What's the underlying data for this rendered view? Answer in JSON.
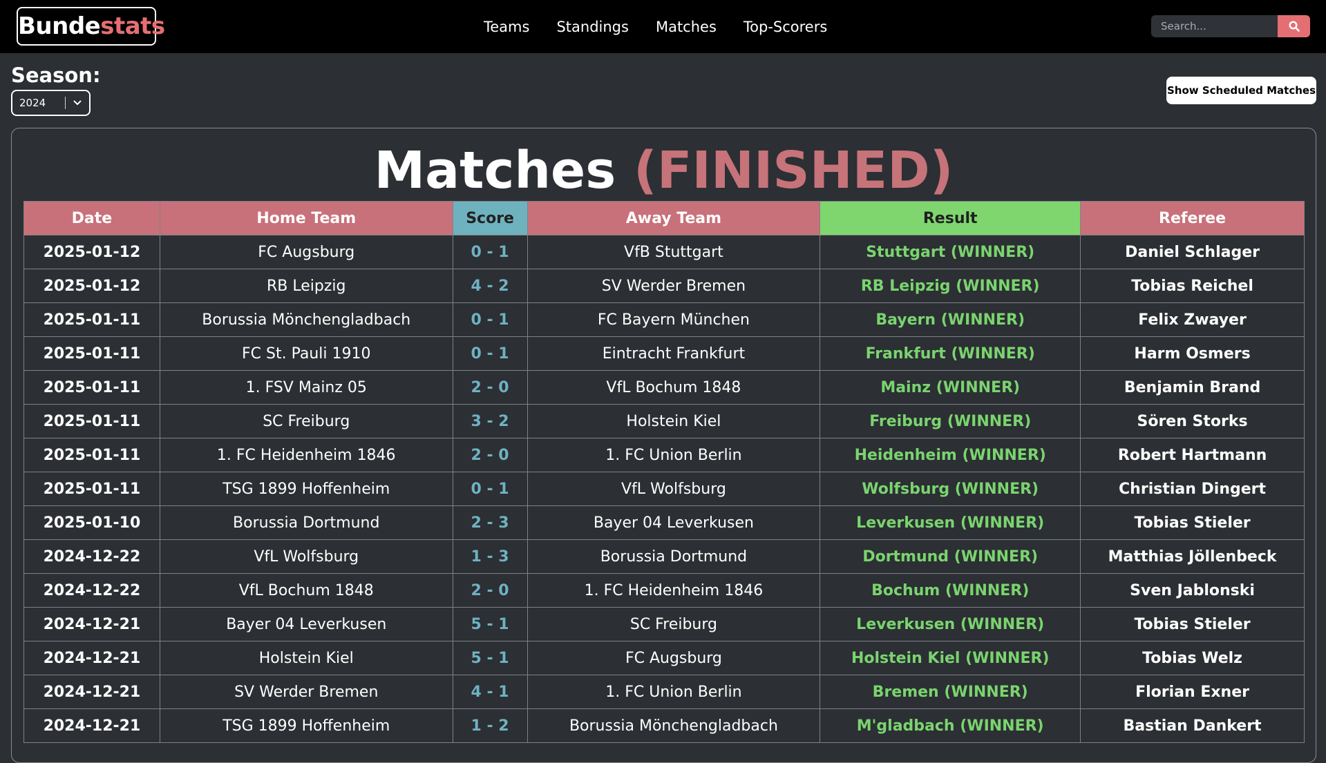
{
  "brand": {
    "part1": "Bunde",
    "part2": "stats"
  },
  "nav": {
    "items": [
      "Teams",
      "Standings",
      "Matches",
      "Top-Scorers"
    ]
  },
  "search": {
    "placeholder": "Search..."
  },
  "season": {
    "label": "Season:",
    "value": "2024"
  },
  "scheduled_button": "Show Scheduled Matches",
  "panel": {
    "title": "Matches",
    "status": "(FINISHED)"
  },
  "colors": {
    "accent": "#e46f72",
    "header_red": "#c8717a",
    "header_blue": "#6fb2bf",
    "header_green": "#7fd66e",
    "score": "#6eb2c3",
    "winner": "#7ad46f"
  },
  "icons": {
    "search": "search-icon",
    "dropdown": "chevron-down-icon"
  },
  "table": {
    "headers": [
      "Date",
      "Home Team",
      "Score",
      "Away Team",
      "Result",
      "Referee"
    ],
    "rows": [
      [
        "2025-01-12",
        "FC Augsburg",
        "0 - 1",
        "VfB Stuttgart",
        "Stuttgart (WINNER)",
        "Daniel Schlager"
      ],
      [
        "2025-01-12",
        "RB Leipzig",
        "4 - 2",
        "SV Werder Bremen",
        "RB Leipzig (WINNER)",
        "Tobias Reichel"
      ],
      [
        "2025-01-11",
        "Borussia Mönchengladbach",
        "0 - 1",
        "FC Bayern München",
        "Bayern (WINNER)",
        "Felix Zwayer"
      ],
      [
        "2025-01-11",
        "FC St. Pauli 1910",
        "0 - 1",
        "Eintracht Frankfurt",
        "Frankfurt (WINNER)",
        "Harm Osmers"
      ],
      [
        "2025-01-11",
        "1. FSV Mainz 05",
        "2 - 0",
        "VfL Bochum 1848",
        "Mainz (WINNER)",
        "Benjamin Brand"
      ],
      [
        "2025-01-11",
        "SC Freiburg",
        "3 - 2",
        "Holstein Kiel",
        "Freiburg (WINNER)",
        "Sören Storks"
      ],
      [
        "2025-01-11",
        "1. FC Heidenheim 1846",
        "2 - 0",
        "1. FC Union Berlin",
        "Heidenheim (WINNER)",
        "Robert Hartmann"
      ],
      [
        "2025-01-11",
        "TSG 1899 Hoffenheim",
        "0 - 1",
        "VfL Wolfsburg",
        "Wolfsburg (WINNER)",
        "Christian Dingert"
      ],
      [
        "2025-01-10",
        "Borussia Dortmund",
        "2 - 3",
        "Bayer 04 Leverkusen",
        "Leverkusen (WINNER)",
        "Tobias Stieler"
      ],
      [
        "2024-12-22",
        "VfL Wolfsburg",
        "1 - 3",
        "Borussia Dortmund",
        "Dortmund (WINNER)",
        "Matthias Jöllenbeck"
      ],
      [
        "2024-12-22",
        "VfL Bochum 1848",
        "2 - 0",
        "1. FC Heidenheim 1846",
        "Bochum (WINNER)",
        "Sven Jablonski"
      ],
      [
        "2024-12-21",
        "Bayer 04 Leverkusen",
        "5 - 1",
        "SC Freiburg",
        "Leverkusen (WINNER)",
        "Tobias Stieler"
      ],
      [
        "2024-12-21",
        "Holstein Kiel",
        "5 - 1",
        "FC Augsburg",
        "Holstein Kiel (WINNER)",
        "Tobias Welz"
      ],
      [
        "2024-12-21",
        "SV Werder Bremen",
        "4 - 1",
        "1. FC Union Berlin",
        "Bremen (WINNER)",
        "Florian Exner"
      ],
      [
        "2024-12-21",
        "TSG 1899 Hoffenheim",
        "1 - 2",
        "Borussia Mönchengladbach",
        "M'gladbach (WINNER)",
        "Bastian Dankert"
      ]
    ]
  }
}
